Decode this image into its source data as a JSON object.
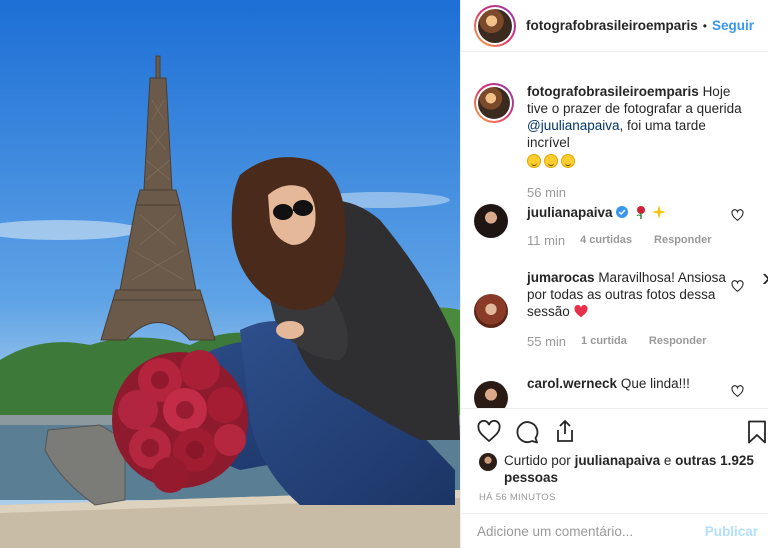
{
  "post": {
    "author": "fotografobrasileiroemparis",
    "follow_label": "Seguir",
    "separator": "•",
    "caption_author": "fotografobrasileiroemparis",
    "caption_text_1": "Hoje tive o prazer de fotografar a querida",
    "caption_mention": "@juulianapaiva",
    "caption_text_2": ", foi uma tarde incrível",
    "caption_time": "56 min"
  },
  "comments": [
    {
      "user": "juulianapaiva",
      "text": "",
      "verified": true,
      "time": "11 min",
      "likes": "4 curtidas",
      "reply": "Responder"
    },
    {
      "user": "jumarocas",
      "text": "Maravilhosa! Ansiosa por todas as outras fotos dessa sessão",
      "time": "55 min",
      "likes": "1 curtida",
      "reply": "Responder"
    },
    {
      "user": "carol.werneck",
      "text": "Que linda!!!"
    }
  ],
  "likes": {
    "prefix": "Curtido por",
    "user": "juulianapaiva",
    "and": "e",
    "others": "outras 1.925 pessoas"
  },
  "timestamp": "HÁ 56 MINUTOS",
  "comment_box": {
    "placeholder": "Adicione um comentário...",
    "publish_label": "Publicar"
  },
  "colors": {
    "link_blue": "#3897f0",
    "mention_blue": "#003569",
    "muted_gray": "#999999",
    "publish_disabled": "#b2dffc"
  }
}
